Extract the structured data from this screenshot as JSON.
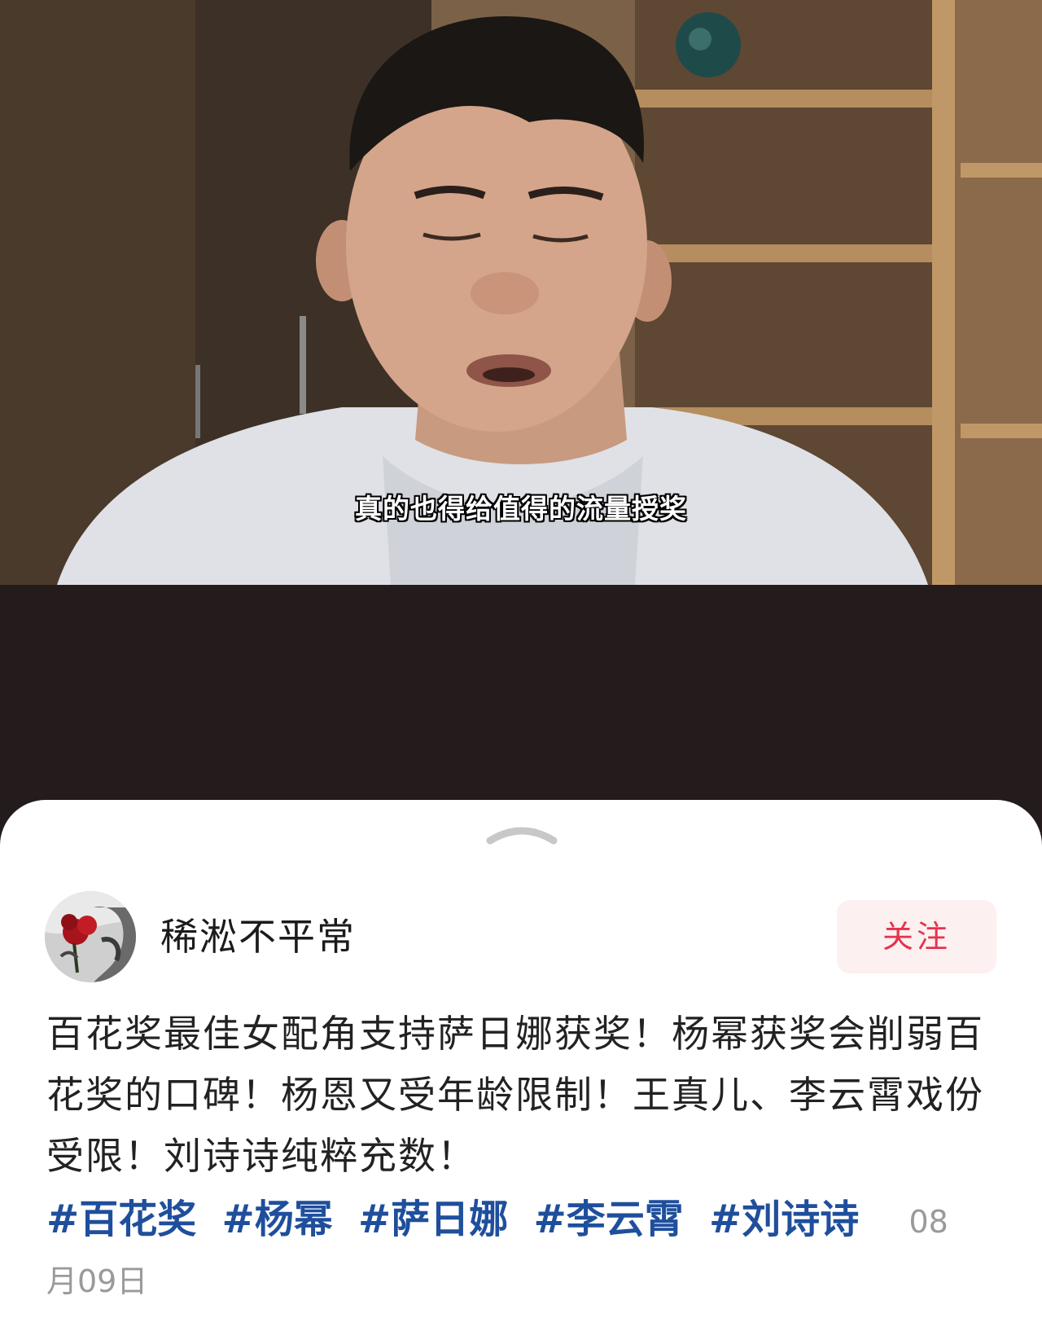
{
  "video": {
    "subtitle": "真的也得给值得的流量授奖"
  },
  "post": {
    "author": "稀淞不平常",
    "follow_label": "关注",
    "text": "百花奖最佳女配角支持萨日娜获奖！杨幂获奖会削弱百花奖的口碑！杨恩又受年龄限制！王真儿、李云霄戏份受限！刘诗诗纯粹充数！",
    "tags": [
      "#百花奖",
      "#杨幂",
      "#萨日娜",
      "#李云霄",
      "#刘诗诗"
    ],
    "date_start": "08",
    "date_end": "月09日"
  },
  "colors": {
    "tag": "#1f4f9c",
    "follow_text": "#e5334d",
    "follow_bg": "#fdf0f1",
    "letterbox": "#231b1c"
  },
  "icons": {
    "handle": "chevron-up-icon",
    "avatar": "rose-avatar"
  }
}
